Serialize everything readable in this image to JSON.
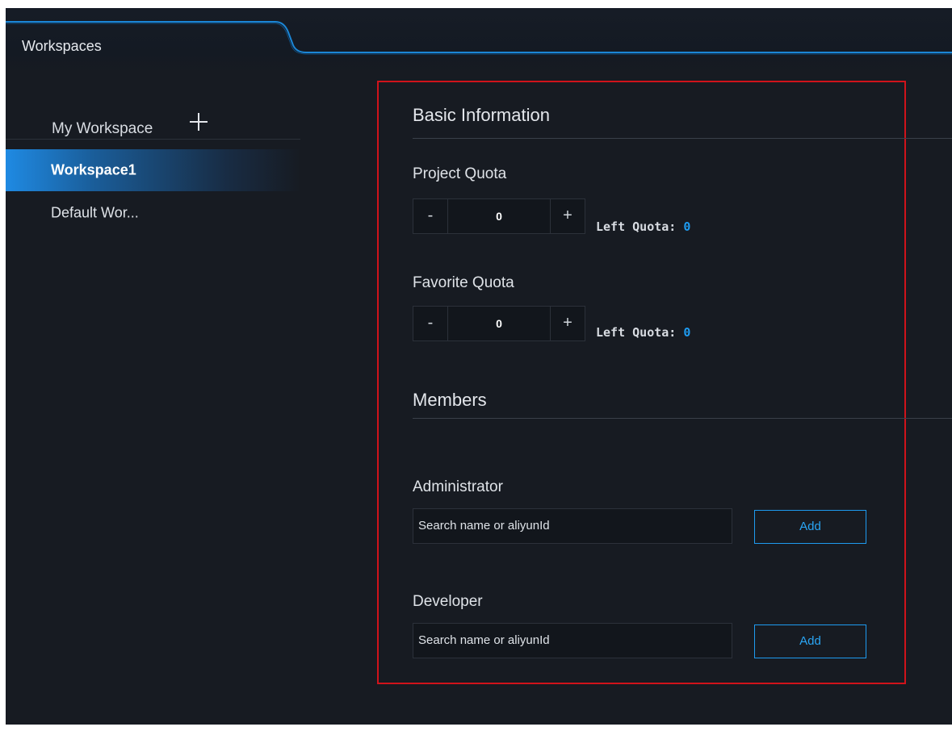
{
  "header": {
    "tab_title": "Workspaces"
  },
  "sidebar": {
    "title": "My Workspace",
    "items": [
      {
        "label": "Workspace1",
        "active": true
      },
      {
        "label": "Default Wor..."
      }
    ]
  },
  "basic": {
    "title": "Basic Information",
    "project_quota": {
      "label": "Project Quota",
      "value": "0",
      "minus": "-",
      "plus": "+",
      "left_label": "Left Quota:",
      "left_value": "0"
    },
    "favorite_quota": {
      "label": "Favorite Quota",
      "value": "0",
      "minus": "-",
      "plus": "+",
      "left_label": "Left Quota:",
      "left_value": "0"
    }
  },
  "members": {
    "title": "Members",
    "administrator": {
      "label": "Administrator",
      "placeholder": "Search name or aliyunId",
      "add_label": "Add"
    },
    "developer": {
      "label": "Developer",
      "placeholder": "Search name or aliyunId",
      "add_label": "Add"
    }
  },
  "colors": {
    "accent": "#1e9bf0",
    "highlight_border": "#d0131b",
    "background": "#171b22"
  }
}
